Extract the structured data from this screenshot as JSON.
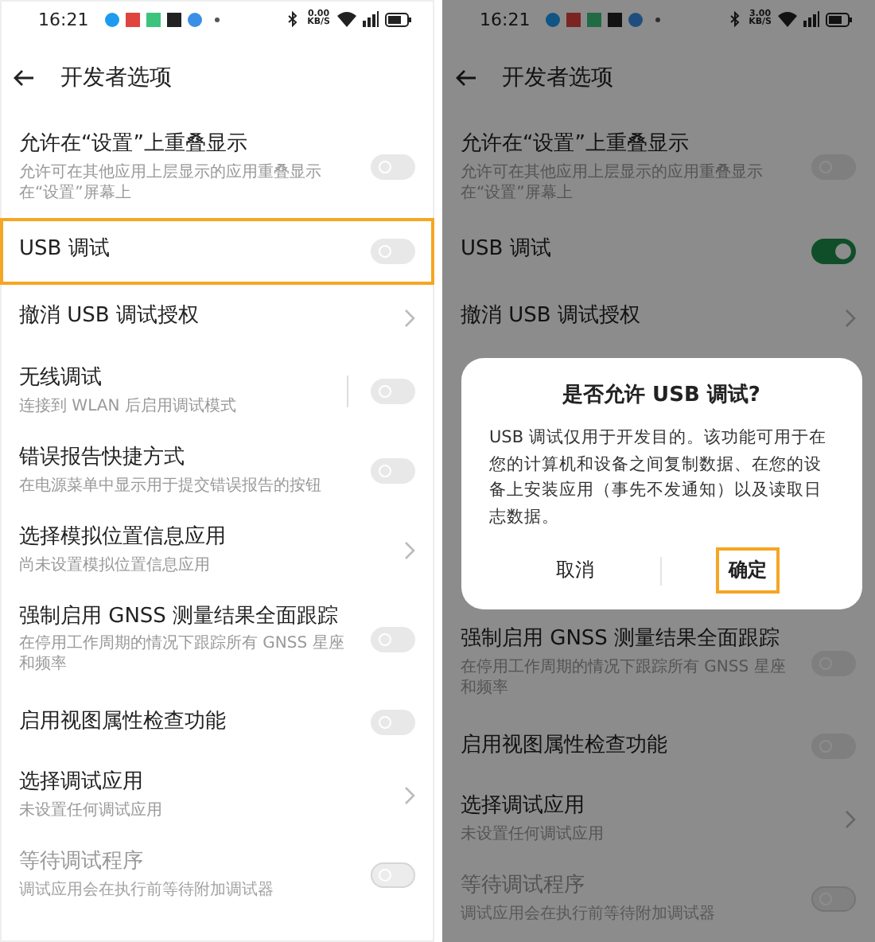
{
  "phones": [
    {
      "status_bar": {
        "time": "16:21",
        "speed": "0.00",
        "speed_unit": "KB/S"
      },
      "header": {
        "title": "开发者选项"
      },
      "dimmed": false,
      "items": [
        {
          "kind": "toggle",
          "title": "允许在“设置”上重叠显示",
          "subtitle": "允许可在其他应用上层显示的应用重叠显示在“设置”屏幕上",
          "on": false,
          "disabled": false,
          "highlighted": false
        },
        {
          "kind": "toggle",
          "title": "USB 调试",
          "on": false,
          "disabled": false,
          "highlighted": true
        },
        {
          "kind": "link",
          "title": "撤消 USB 调试授权",
          "disabled": false,
          "highlighted": false
        },
        {
          "kind": "split_toggle",
          "title": "无线调试",
          "subtitle": "连接到 WLAN 后启用调试模式",
          "on": false,
          "disabled": false,
          "highlighted": false
        },
        {
          "kind": "toggle",
          "title": "错误报告快捷方式",
          "subtitle": "在电源菜单中显示用于提交错误报告的按钮",
          "on": false,
          "disabled": false,
          "highlighted": false
        },
        {
          "kind": "link",
          "title": "选择模拟位置信息应用",
          "subtitle": "尚未设置模拟位置信息应用",
          "disabled": false,
          "highlighted": false
        },
        {
          "kind": "toggle",
          "title": "强制启用 GNSS 测量结果全面跟踪",
          "subtitle": "在停用工作周期的情况下跟踪所有 GNSS 星座和频率",
          "on": false,
          "disabled": false,
          "highlighted": false
        },
        {
          "kind": "toggle",
          "title": "启用视图属性检查功能",
          "on": false,
          "disabled": false,
          "highlighted": false
        },
        {
          "kind": "link",
          "title": "选择调试应用",
          "subtitle": "未设置任何调试应用",
          "disabled": false,
          "highlighted": false
        },
        {
          "kind": "toggle",
          "title": "等待调试程序",
          "subtitle": "调试应用会在执行前等待附加调试器",
          "on": false,
          "disabled": true,
          "highlighted": false
        }
      ]
    },
    {
      "status_bar": {
        "time": "16:21",
        "speed": "3.00",
        "speed_unit": "KB/S"
      },
      "header": {
        "title": "开发者选项"
      },
      "dimmed": true,
      "items": [
        {
          "kind": "toggle",
          "title": "允许在“设置”上重叠显示",
          "subtitle": "允许可在其他应用上层显示的应用重叠显示在“设置”屏幕上",
          "on": false,
          "disabled": false,
          "highlighted": false
        },
        {
          "kind": "toggle",
          "title": "USB 调试",
          "on": true,
          "disabled": false,
          "highlighted": false
        },
        {
          "kind": "link",
          "title": "撤消 USB 调试授权",
          "disabled": false,
          "highlighted": false
        }
      ],
      "dialog": {
        "title": "是否允许 USB 调试?",
        "message": "USB 调试仅用于开发目的。该功能可用于在您的计算机和设备之间复制数据、在您的设备上安装应用（事先不发通知）以及读取日志数据。",
        "buttons": [
          {
            "label": "取消",
            "highlighted": false
          },
          {
            "label": "确定",
            "highlighted": true
          }
        ]
      },
      "items_below": [
        {
          "kind": "toggle",
          "title": "强制启用 GNSS 测量结果全面跟踪",
          "subtitle": "在停用工作周期的情况下跟踪所有 GNSS 星座和频率",
          "on": false,
          "disabled": false,
          "highlighted": false
        },
        {
          "kind": "toggle",
          "title": "启用视图属性检查功能",
          "on": false,
          "disabled": false,
          "highlighted": false
        },
        {
          "kind": "link",
          "title": "选择调试应用",
          "subtitle": "未设置任何调试应用",
          "disabled": false,
          "highlighted": false
        },
        {
          "kind": "toggle",
          "title": "等待调试程序",
          "subtitle": "调试应用会在执行前等待附加调试器",
          "on": false,
          "disabled": true,
          "highlighted": false
        }
      ]
    }
  ]
}
